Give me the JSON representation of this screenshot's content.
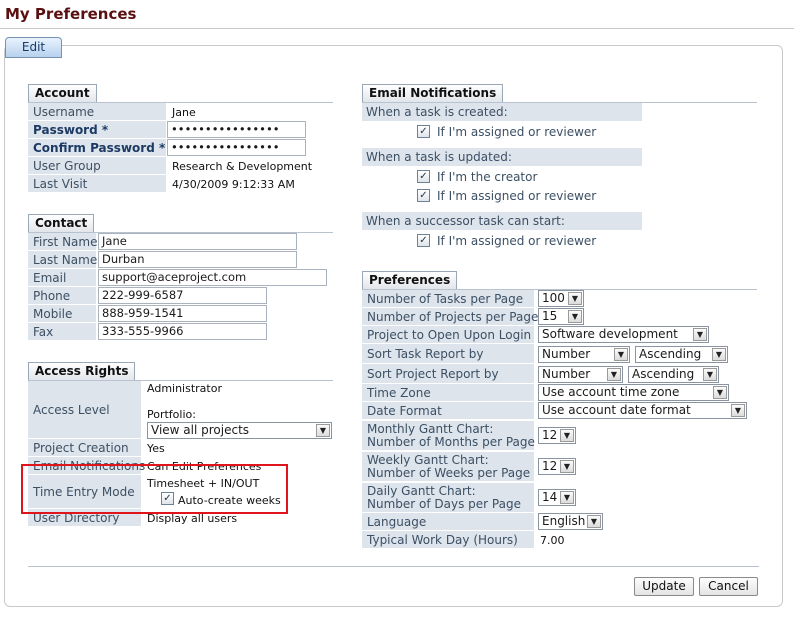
{
  "page": {
    "title": "My Preferences",
    "edit_tab": "Edit"
  },
  "account": {
    "header": "Account",
    "username": {
      "label": "Username",
      "value": "Jane"
    },
    "password": {
      "label": "Password *",
      "value": "••••••••••••••••"
    },
    "confirm_password": {
      "label": "Confirm Password *",
      "value": "••••••••••••••••"
    },
    "user_group": {
      "label": "User Group",
      "value": "Research & Development"
    },
    "last_visit": {
      "label": "Last Visit",
      "value": "4/30/2009 9:12:33 AM"
    }
  },
  "contact": {
    "header": "Contact",
    "first_name": {
      "label": "First Name",
      "value": "Jane"
    },
    "last_name": {
      "label": "Last Name",
      "value": "Durban"
    },
    "email": {
      "label": "Email",
      "value": "support@aceproject.com"
    },
    "phone": {
      "label": "Phone",
      "value": "222-999-6587"
    },
    "mobile": {
      "label": "Mobile",
      "value": "888-959-1541"
    },
    "fax": {
      "label": "Fax",
      "value": "333-555-9966"
    }
  },
  "access_rights": {
    "header": "Access Rights",
    "access_level": {
      "label": "Access Level",
      "value": "Administrator",
      "portfolio_label": "Portfolio:",
      "portfolio_value": "View all projects"
    },
    "project_creation": {
      "label": "Project Creation",
      "value": "Yes"
    },
    "email_notifications": {
      "label": "Email Notifications",
      "value": "Can Edit Preferences"
    },
    "time_entry_mode": {
      "label": "Time Entry Mode",
      "value": "Timesheet + IN/OUT",
      "checkbox_label": "Auto-create weeks",
      "checked": true
    },
    "user_directory": {
      "label": "User Directory",
      "value": "Display all users"
    }
  },
  "email_notifications": {
    "header": "Email Notifications",
    "task_created": {
      "label": "When a task is created:",
      "opt_assigned": "If I'm assigned or reviewer"
    },
    "task_updated": {
      "label": "When a task is updated:",
      "opt_creator": "If I'm the creator",
      "opt_assigned": "If I'm assigned or reviewer"
    },
    "successor_start": {
      "label": "When a successor task can start:",
      "opt_assigned": "If I'm assigned or reviewer"
    },
    "check_mark": "✓"
  },
  "preferences": {
    "header": "Preferences",
    "tasks_per_page": {
      "label": "Number of Tasks per Page",
      "value": "100"
    },
    "projects_per_page": {
      "label": "Number of Projects per Page",
      "value": "15"
    },
    "project_on_login": {
      "label": "Project to Open Upon Login",
      "value": "Software development"
    },
    "sort_task_report": {
      "label": "Sort Task Report by",
      "field": "Number",
      "order": "Ascending"
    },
    "sort_project_report": {
      "label": "Sort Project Report by",
      "field": "Number",
      "order": "Ascending"
    },
    "time_zone": {
      "label": "Time Zone",
      "value": "Use account time zone"
    },
    "date_format": {
      "label": "Date Format",
      "value": "Use account date format"
    },
    "monthly_gantt": {
      "label_line1": "Monthly Gantt Chart:",
      "label_line2": "Number of Months per Page",
      "value": "12"
    },
    "weekly_gantt": {
      "label_line1": "Weekly Gantt Chart:",
      "label_line2": "Number of Weeks per Page",
      "value": "12"
    },
    "daily_gantt": {
      "label_line1": "Daily Gantt Chart:",
      "label_line2": "Number of Days per Page",
      "value": "14"
    },
    "language": {
      "label": "Language",
      "value": "English"
    },
    "work_day": {
      "label": "Typical Work Day (Hours)",
      "value": "7.00"
    }
  },
  "actions": {
    "update": "Update",
    "cancel": "Cancel"
  },
  "icons": {
    "dropdown": "chevron-down-icon",
    "checkbox": "checkmark-icon"
  },
  "colors": {
    "title": "#5a1010",
    "label_bg": "#dde4ec",
    "highlight": "#e0151b"
  }
}
